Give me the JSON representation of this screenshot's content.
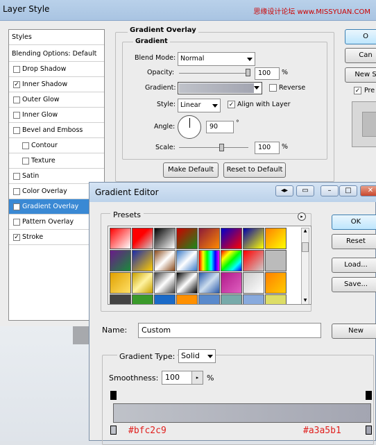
{
  "layer_style": {
    "title": "Layer Style",
    "watermark": "思缘设计论坛 www.MISSYUAN.COM",
    "sidebar": {
      "items": [
        {
          "label": "Styles",
          "checkbox": false,
          "checked": false,
          "sub": false
        },
        {
          "label": "Blending Options: Default",
          "checkbox": false,
          "checked": false,
          "sub": false
        },
        {
          "label": "Drop Shadow",
          "checkbox": true,
          "checked": false,
          "sub": false
        },
        {
          "label": "Inner Shadow",
          "checkbox": true,
          "checked": true,
          "sub": false
        },
        {
          "label": "Outer Glow",
          "checkbox": true,
          "checked": false,
          "sub": false
        },
        {
          "label": "Inner Glow",
          "checkbox": true,
          "checked": false,
          "sub": false
        },
        {
          "label": "Bevel and Emboss",
          "checkbox": true,
          "checked": false,
          "sub": false
        },
        {
          "label": "Contour",
          "checkbox": true,
          "checked": false,
          "sub": true
        },
        {
          "label": "Texture",
          "checkbox": true,
          "checked": false,
          "sub": true
        },
        {
          "label": "Satin",
          "checkbox": true,
          "checked": false,
          "sub": false
        },
        {
          "label": "Color Overlay",
          "checkbox": true,
          "checked": false,
          "sub": false
        },
        {
          "label": "Gradient Overlay",
          "checkbox": true,
          "checked": true,
          "sub": false,
          "selected": true
        },
        {
          "label": "Pattern Overlay",
          "checkbox": true,
          "checked": false,
          "sub": false
        },
        {
          "label": "Stroke",
          "checkbox": true,
          "checked": true,
          "sub": false
        }
      ]
    },
    "panel": {
      "title": "Gradient Overlay",
      "group": "Gradient",
      "blend_mode_label": "Blend Mode:",
      "blend_mode": "Normal",
      "opacity_label": "Opacity:",
      "opacity": "100",
      "opacity_pct": 100,
      "gradient_label": "Gradient:",
      "reverse_label": "Reverse",
      "style_label": "Style:",
      "style": "Linear",
      "align_label": "Align with Layer",
      "angle_label": "Angle:",
      "angle": "90",
      "degree": "°",
      "scale_label": "Scale:",
      "scale": "100",
      "scale_pct": 100,
      "pct": "%",
      "make_default": "Make Default",
      "reset_default": "Reset to Default"
    },
    "right_buttons": {
      "ok": "O",
      "cancel": "Can",
      "new_style": "New S",
      "preview": "Pre"
    }
  },
  "gradient_editor": {
    "title": "Gradient Editor",
    "presets_label": "Presets",
    "ok": "OK",
    "reset": "Reset",
    "load": "Load...",
    "save": "Save...",
    "name_label": "Name:",
    "name_value": "Custom",
    "new": "New",
    "type_label": "Gradient Type:",
    "type_value": "Solid",
    "smoothness_label": "Smoothness:",
    "smoothness_value": "100",
    "pct": "%",
    "color_left": "#bfc2c9",
    "color_right": "#a3a5b1",
    "hex_left": "#bfc2c9",
    "hex_right": "#a3a5b1"
  }
}
